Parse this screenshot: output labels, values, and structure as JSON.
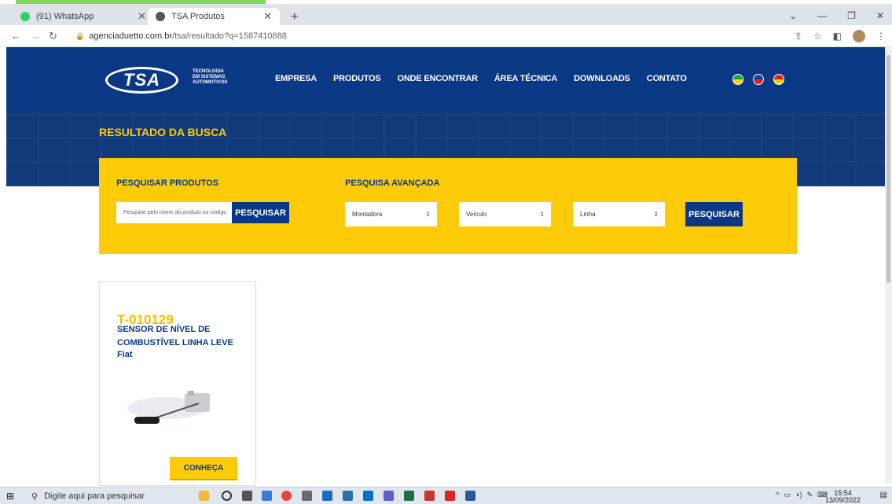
{
  "browser": {
    "tabs": [
      {
        "label": "(91) WhatsApp"
      },
      {
        "label": "TSA Produtos"
      }
    ],
    "url_host": "agenciaduetto.com.br",
    "url_path": "/tsa/resultado?q=1587410688"
  },
  "site": {
    "logo_text": "TSA",
    "tagline": [
      "TECNOLOGIA",
      "EM SISTEMAS",
      "AUTOMOTIVOS"
    ],
    "nav": [
      "EMPRESA",
      "PRODUTOS",
      "ONDE ENCONTRAR",
      "ÁREA TÉCNICA",
      "DOWNLOADS",
      "CONTATO"
    ],
    "result_title": "RESULTADO DA BUSCA"
  },
  "search": {
    "products_label": "PESQUISAR PRODUTOS",
    "input_placeholder": "Pesquise pelo nome do produto ou código",
    "search_button": "PESQUISAR",
    "advanced_label": "PESQUISA AVANÇADA",
    "selects": [
      "Montadora",
      "Veículo",
      "Linha"
    ],
    "advanced_button": "PESQUISAR"
  },
  "product": {
    "code": "T-010129",
    "name": "SENSOR DE NÍVEL DE COMBUSTÍVEL LINHA LEVE",
    "brand": "Fiat",
    "button": "CONHEÇA"
  },
  "taskbar": {
    "search_placeholder": "Digite aqui para pesquisar",
    "time": "15:54",
    "date": "13/09/2022"
  },
  "colors": {
    "brand_blue": "#0a3885",
    "brand_yellow": "#fecb08"
  }
}
